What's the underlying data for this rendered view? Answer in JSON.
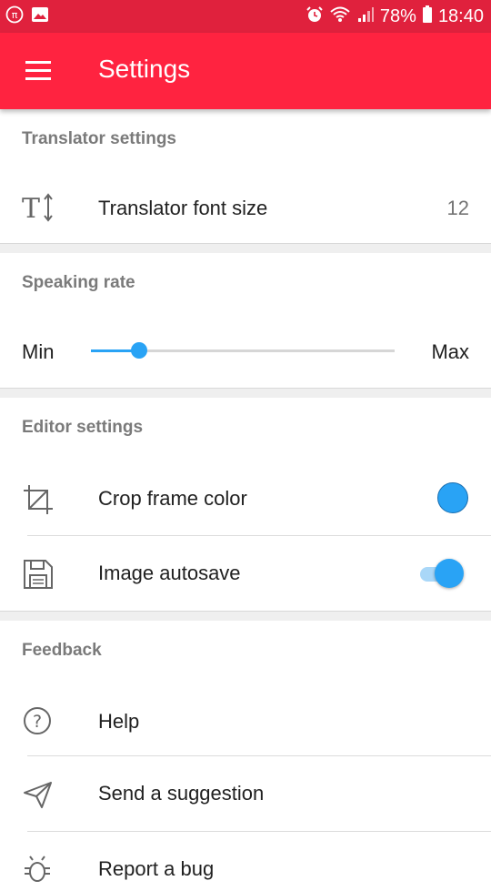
{
  "status_bar": {
    "left_icons": [
      "pi-app-icon",
      "image-icon"
    ],
    "right_icons": [
      "alarm-icon",
      "wifi-icon",
      "signal-icon",
      "battery-icon"
    ],
    "battery": "78%",
    "time": "18:40"
  },
  "app_bar": {
    "menu_icon": "hamburger-menu-icon",
    "title": "Settings"
  },
  "sections": {
    "translator": {
      "header": "Translator settings",
      "font_size": {
        "icon": "text-size-icon",
        "label": "Translator font size",
        "value": "12"
      }
    },
    "speaking": {
      "header": "Speaking rate",
      "min_label": "Min",
      "max_label": "Max",
      "level": 0.16
    },
    "editor": {
      "header": "Editor settings",
      "crop": {
        "icon": "crop-icon",
        "label": "Crop frame color",
        "color": "#29a3f5"
      },
      "autosave": {
        "icon": "floppy-disk-icon",
        "label": "Image autosave",
        "enabled": true
      }
    },
    "feedback": {
      "header": "Feedback",
      "help": {
        "icon": "help-circle-icon",
        "label": "Help"
      },
      "suggestion": {
        "icon": "send-plane-icon",
        "label": "Send a suggestion"
      },
      "bug": {
        "icon": "bug-icon",
        "label": "Report a bug"
      }
    }
  },
  "colors": {
    "accent": "#ff2340",
    "status_bar": "#e0213d",
    "control": "#29a3f5"
  }
}
